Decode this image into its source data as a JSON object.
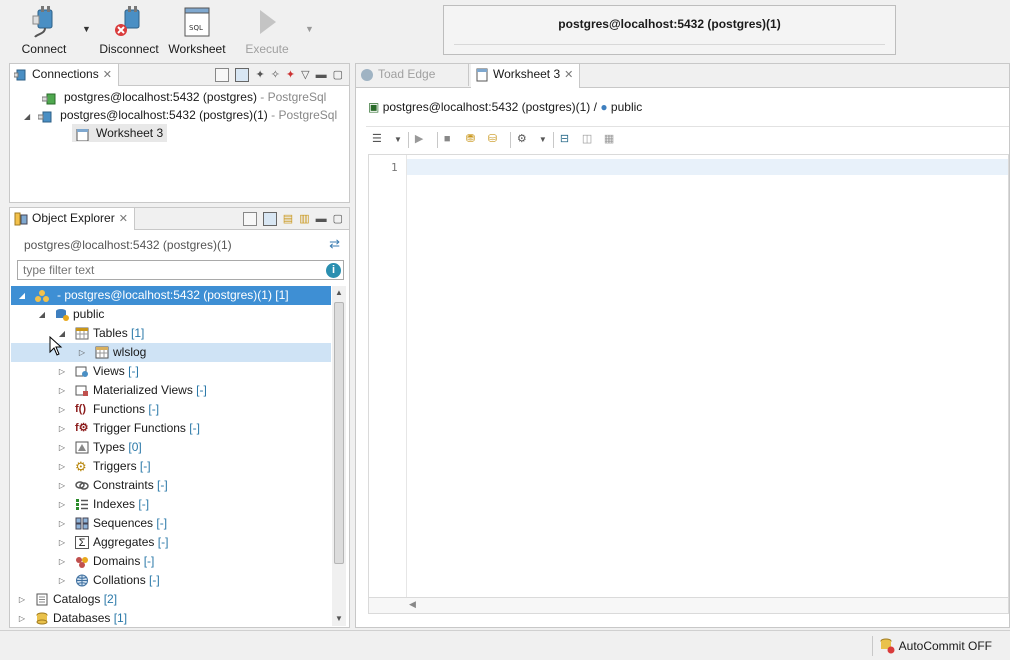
{
  "toolbar": {
    "connect_label": "Connect",
    "disconnect_label": "Disconnect",
    "worksheet_label": "Worksheet",
    "execute_label": "Execute",
    "connection_title": "postgres@localhost:5432 (postgres)(1)"
  },
  "connections": {
    "tab_label": "Connections",
    "items": [
      {
        "name": "postgres@localhost:5432 (postgres)",
        "type": " - PostgreSql"
      },
      {
        "name": "postgres@localhost:5432 (postgres)(1)",
        "type": " - PostgreSql"
      }
    ],
    "worksheet": "Worksheet 3"
  },
  "explorer": {
    "tab_label": "Object Explorer",
    "connection": "postgres@localhost:5432 (postgres)(1)",
    "filter_placeholder": "type filter text",
    "root": {
      "label": "- postgres@localhost:5432 (postgres)(1)",
      "count": "[1]"
    },
    "schema": "public",
    "tables": {
      "label": "Tables",
      "count": "[1]"
    },
    "table_item": "wlslog",
    "nodes": [
      {
        "label": "Views",
        "count": "[-]"
      },
      {
        "label": "Materialized Views",
        "count": "[-]"
      },
      {
        "label": "Functions",
        "count": "[-]"
      },
      {
        "label": "Trigger Functions",
        "count": "[-]"
      },
      {
        "label": "Types",
        "count": "[0]"
      },
      {
        "label": "Triggers",
        "count": "[-]"
      },
      {
        "label": "Constraints",
        "count": "[-]"
      },
      {
        "label": "Indexes",
        "count": "[-]"
      },
      {
        "label": "Sequences",
        "count": "[-]"
      },
      {
        "label": "Aggregates",
        "count": "[-]"
      },
      {
        "label": "Domains",
        "count": "[-]"
      },
      {
        "label": "Collations",
        "count": "[-]"
      }
    ],
    "catalogs": {
      "label": "Catalogs",
      "count": "[2]"
    },
    "databases": {
      "label": "Databases",
      "count": "[1]"
    }
  },
  "editor": {
    "tabs": [
      "Toad Edge",
      "Worksheet 3"
    ],
    "breadcrumb_conn": "postgres@localhost:5432 (postgres)(1) /",
    "breadcrumb_schema": "public",
    "line_number": "1"
  },
  "status": {
    "autocommit": "AutoCommit OFF"
  },
  "colors": {
    "selection": "#3e8fd4",
    "count": "#2a78a8",
    "hover_row": "#cfe3f5"
  }
}
